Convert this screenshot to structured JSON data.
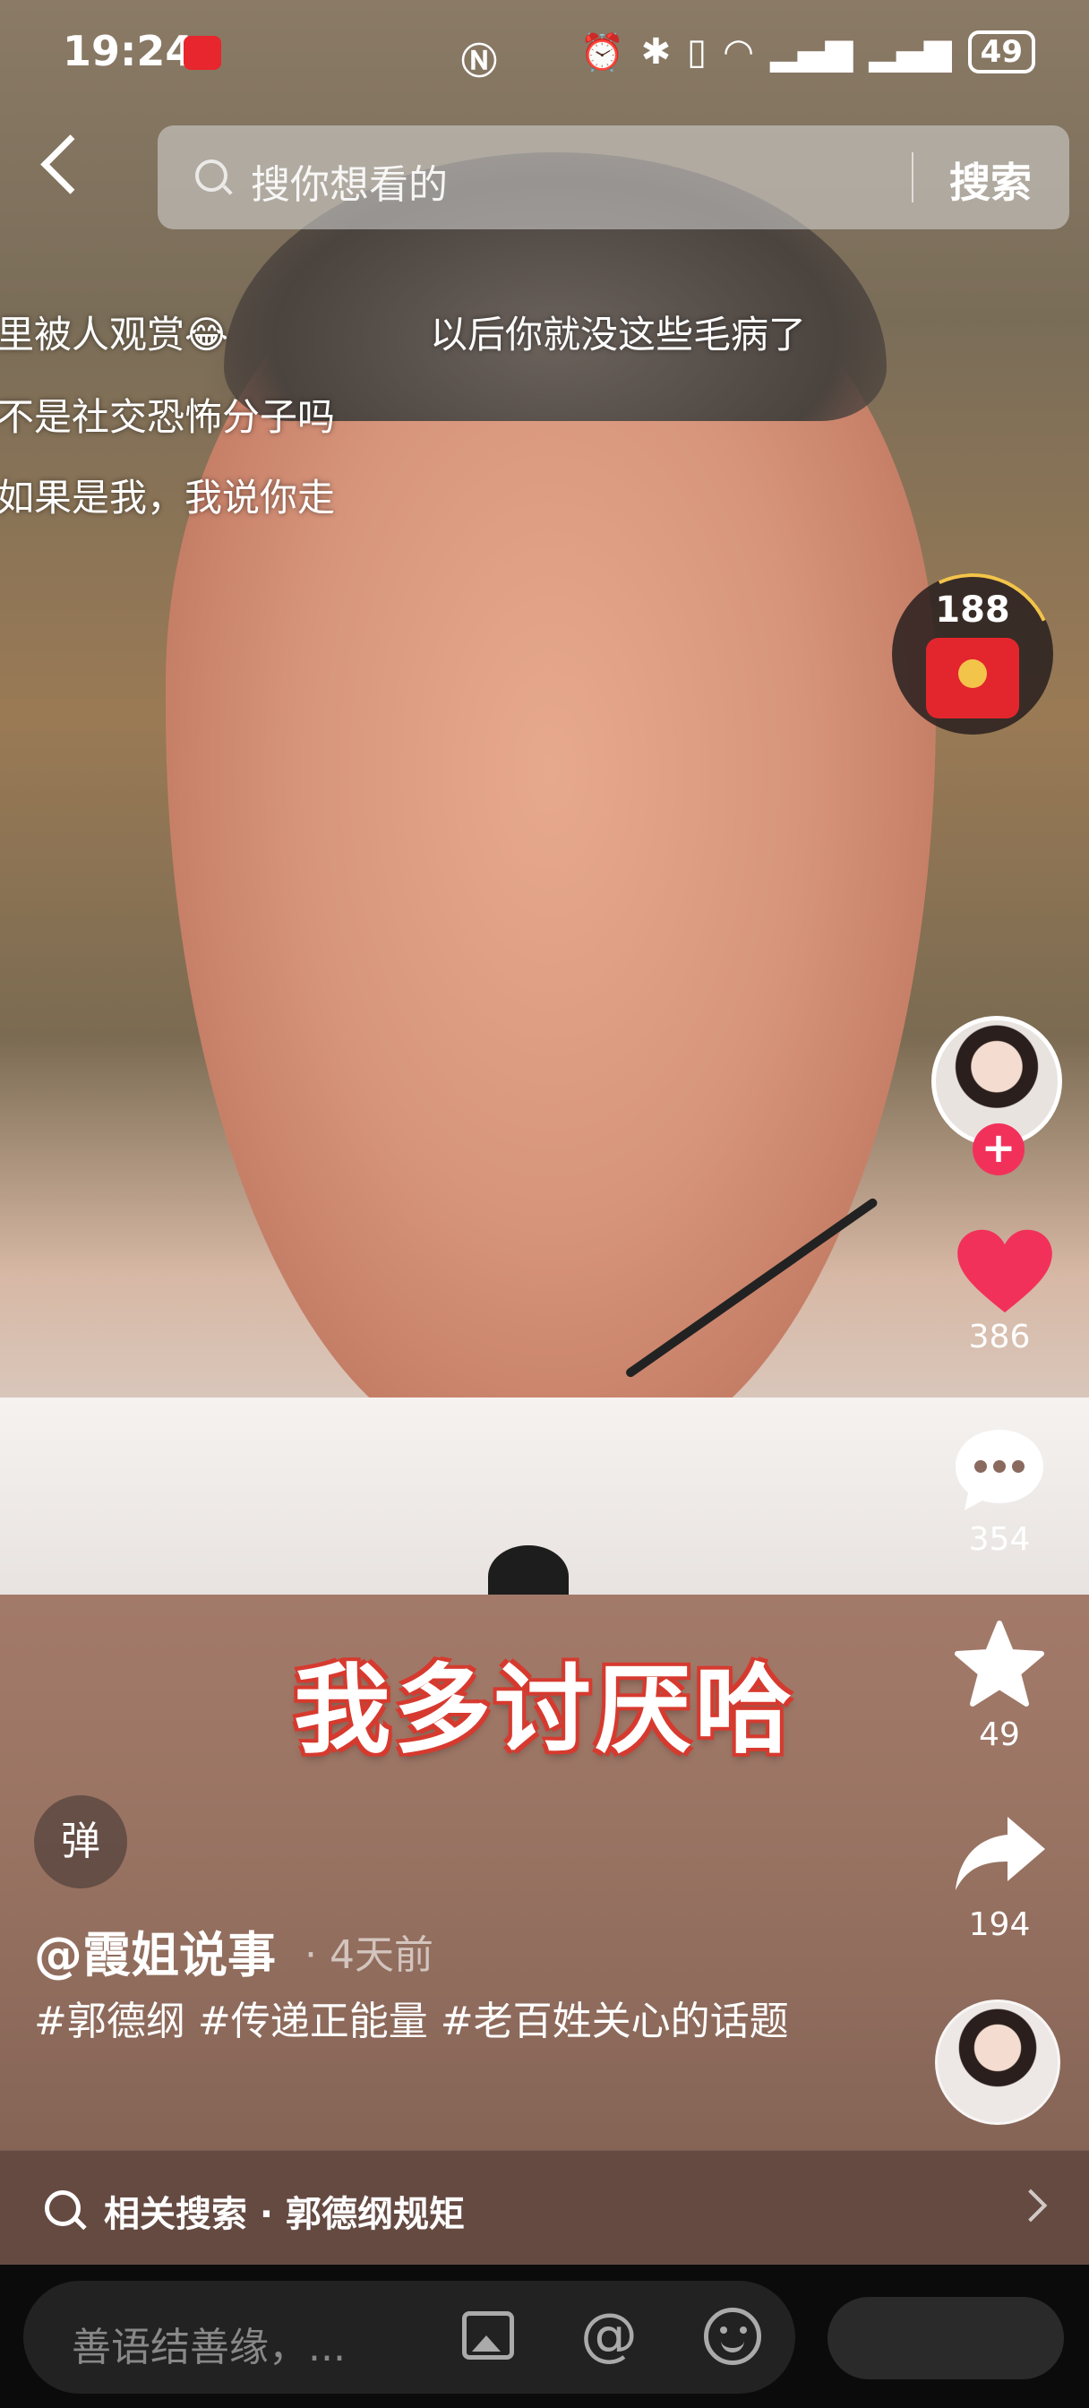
{
  "status_bar": {
    "time": "19:24",
    "battery": "49"
  },
  "search": {
    "placeholder": "搜你想看的",
    "button_label": "搜索"
  },
  "danmaku": [
    "里被人观赏😂",
    "以后你就没这些毛病了",
    "不是社交恐怖分子吗",
    "如果是我，我说你走"
  ],
  "red_packet": {
    "count": "188"
  },
  "actions": {
    "like_count": "386",
    "comment_count": "354",
    "favorite_count": "49",
    "share_count": "194"
  },
  "video": {
    "caption": "我多讨厌哈"
  },
  "post": {
    "danmu_label": "弹",
    "author": "@霞姐说事",
    "time": "· 4天前",
    "hashtags": "#郭德纲 #传递正能量 #老百姓关心的话题"
  },
  "related": {
    "text": "相关搜索 · 郭德纲规矩"
  },
  "comment_bar": {
    "placeholder": "善语结善缘，..."
  },
  "colors": {
    "like": "#f2315a",
    "red_packet": "#e3262d",
    "caption_outline": "#d63a2f"
  },
  "icons": [
    "back-icon",
    "search-icon",
    "heart-icon",
    "comment-icon",
    "star-icon",
    "share-icon",
    "image-icon",
    "at-icon",
    "emoji-icon",
    "chevron-right-icon"
  ]
}
